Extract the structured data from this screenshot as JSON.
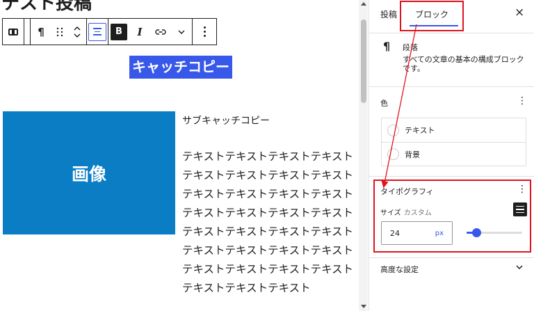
{
  "editor": {
    "title": "テスト投稿",
    "catch_copy": "キャッチコピー",
    "image_label": "画像",
    "sub_catch": "サブキャッチコピー",
    "body_lines": [
      "テキストテキストテキストテキスト",
      "テキストテキストテキストテキスト",
      "テキストテキストテキストテキスト",
      "テキストテキストテキストテキスト",
      "テキストテキストテキストテキスト",
      "テキストテキストテキストテキスト",
      "テキストテキストテキストテキスト",
      "テキストテキストテキスト"
    ]
  },
  "toolbar": {
    "paragraph_glyph": "¶",
    "bold_label": "B",
    "italic_label": "I",
    "link_glyph": "⊂⊃",
    "more_glyph": "⌄",
    "icons": [
      "block-type-icon",
      "paragraph-icon",
      "drag-handle-icon",
      "move-updown-icon",
      "align-center-icon",
      "bold-icon",
      "italic-icon",
      "link-icon",
      "chevron-down-icon",
      "more-options-icon"
    ]
  },
  "sidebar": {
    "tab_post": "投稿",
    "tab_block": "ブロック",
    "close_glyph": "×",
    "block_name": "段落",
    "block_description": "すべての文章の基本の構成ブロックです。",
    "color_label": "色",
    "color_items": [
      {
        "label": "テキスト"
      },
      {
        "label": "背景"
      }
    ],
    "typography_label": "タイポグラフィ",
    "size_label": "サイズ",
    "size_mode": "カスタム",
    "size_value": "24",
    "size_unit": "px",
    "slider_fraction": 0.18,
    "advanced_label": "高度な設定",
    "kebab_glyph": "⋮",
    "chevron_glyph": "⌄"
  },
  "colors": {
    "accent": "#3858e9",
    "image_bg": "#0a7dc5",
    "annotation": "#e0131d"
  }
}
